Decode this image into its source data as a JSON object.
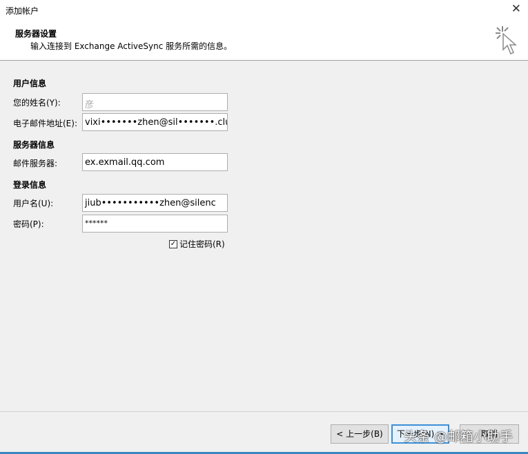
{
  "window": {
    "title": "添加帐户",
    "close": "✕"
  },
  "header": {
    "title": "服务器设置",
    "subtitle": "输入连接到 Exchange ActiveSync 服务所需的信息。"
  },
  "sections": {
    "user": "用户信息",
    "server": "服务器信息",
    "login": "登录信息"
  },
  "fields": {
    "name": {
      "label": "您的姓名(Y):",
      "value": "彦"
    },
    "email": {
      "label": "电子邮件地址(E):",
      "value": "vixi•••••••zhen@sil•••••••.club"
    },
    "mail_server": {
      "label": "邮件服务器:",
      "value": "ex.exmail.qq.com"
    },
    "username": {
      "label": "用户名(U):",
      "value": "jiub•••••••••••zhen@silenc"
    },
    "password": {
      "label": "密码(P):",
      "value": "******"
    }
  },
  "remember": {
    "label": "记住密码(R)",
    "checked": true,
    "mark": "✓"
  },
  "buttons": {
    "back": "< 上一步(B)",
    "next": "下一步(N) >",
    "cancel": "取消"
  },
  "watermark": "头条 @邮箱小助手"
}
